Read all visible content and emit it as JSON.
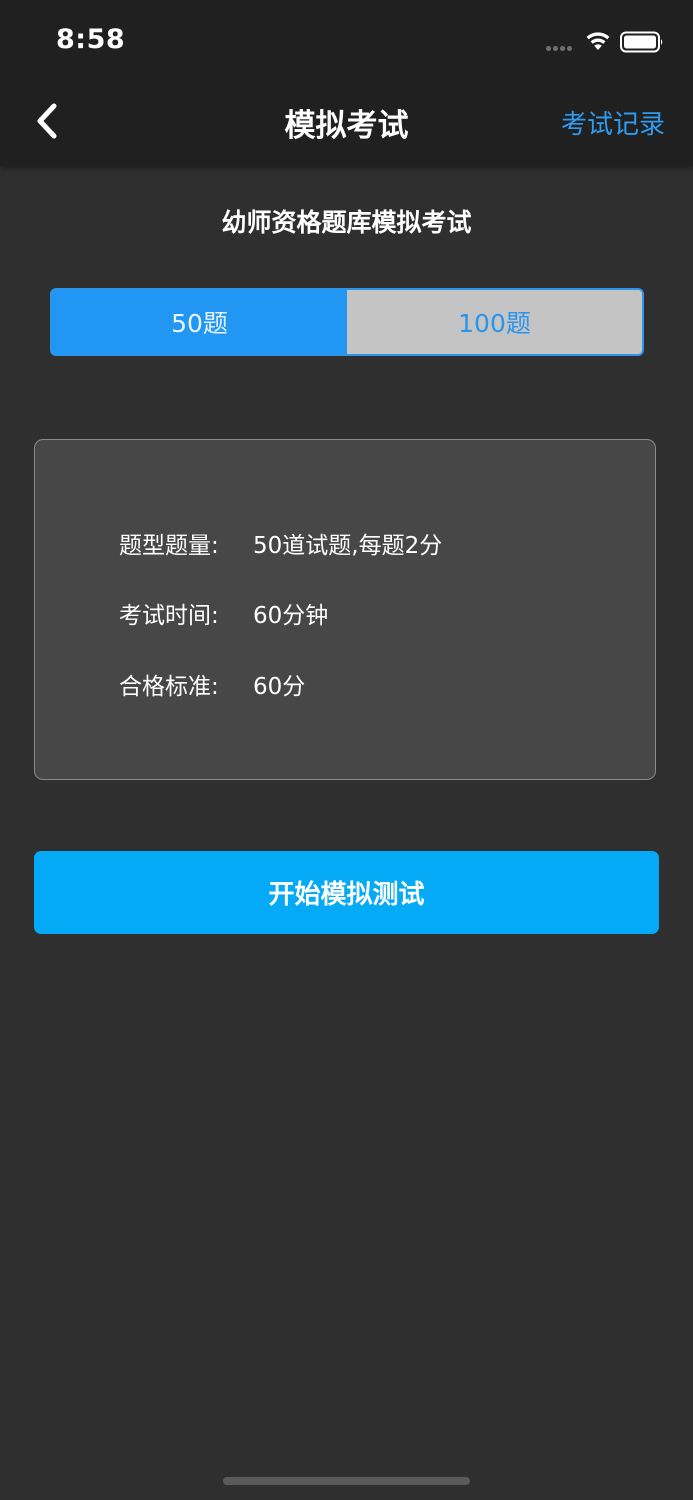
{
  "status_bar": {
    "time": "8:58",
    "icons": [
      "signal-dots-icon",
      "wifi-icon",
      "battery-icon"
    ]
  },
  "nav": {
    "back_icon": "chevron-left-icon",
    "title": "模拟考试",
    "action_label": "考试记录"
  },
  "exam": {
    "name": "幼师资格题库模拟考试"
  },
  "segments": {
    "options": [
      {
        "label": "50题",
        "selected": true
      },
      {
        "label": "100题",
        "selected": false
      }
    ]
  },
  "info": {
    "rows": [
      {
        "label": "题型题量:",
        "value": "50道试题,每题2分"
      },
      {
        "label": "考试时间:",
        "value": "60分钟"
      },
      {
        "label": "合格标准:",
        "value": "60分"
      }
    ]
  },
  "start_button": {
    "label": "开始模拟测试"
  },
  "colors": {
    "accent": "#2196f3",
    "button": "#05aaf7",
    "header_bg": "#202020",
    "page_bg": "#2f2f2f",
    "card_bg": "#474747"
  }
}
